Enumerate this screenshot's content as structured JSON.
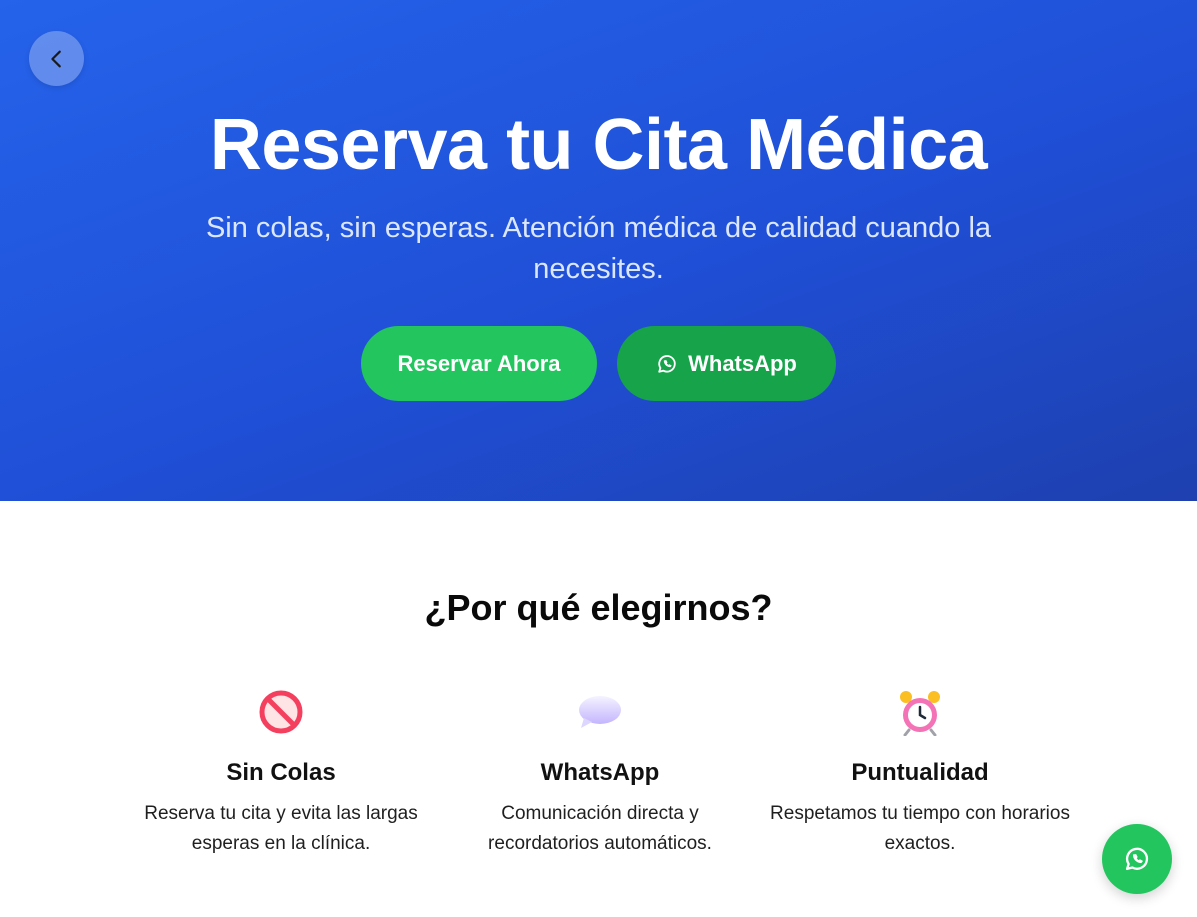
{
  "hero": {
    "title": "Reserva tu Cita Médica",
    "subtitle": "Sin colas, sin esperas. Atención médica de calidad cuando la necesites.",
    "back_icon": "chevron-left-icon",
    "reserve_label": "Reservar Ahora",
    "whatsapp_label": "WhatsApp",
    "whatsapp_icon": "whatsapp-icon"
  },
  "features": {
    "title": "¿Por qué elegirnos?",
    "items": [
      {
        "icon": "no-entry-icon",
        "title": "Sin Colas",
        "text": "Reserva tu cita y evita las largas esperas en la clínica."
      },
      {
        "icon": "speech-bubble-icon",
        "title": "WhatsApp",
        "text": "Comunicación directa y recordatorios automáticos."
      },
      {
        "icon": "alarm-clock-icon",
        "title": "Puntualidad",
        "text": "Respetamos tu tiempo con horarios exactos."
      }
    ]
  },
  "floating_button": {
    "icon": "whatsapp-icon"
  },
  "colors": {
    "hero_gradient_start": "#2563eb",
    "hero_gradient_end": "#1e40af",
    "primary_green": "#22c55e",
    "dark_green": "#16a34a"
  }
}
